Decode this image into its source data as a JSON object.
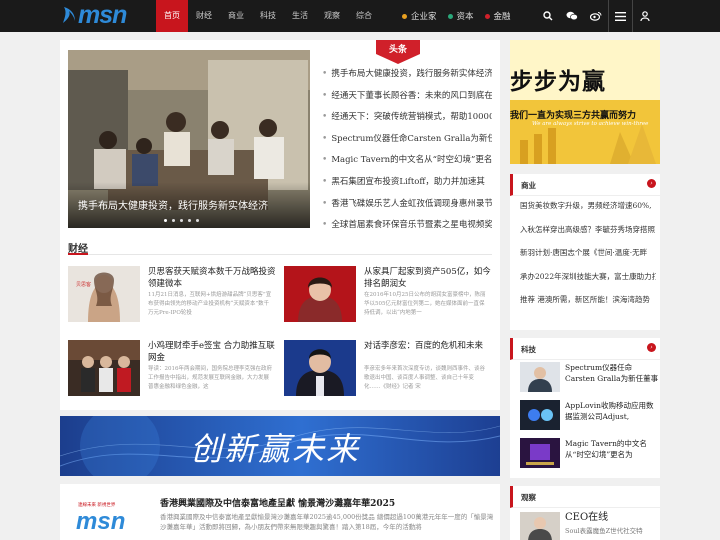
{
  "logo": {
    "text": "msn"
  },
  "nav": [
    "首页",
    "财经",
    "商业",
    "科技",
    "生活",
    "观察",
    "综合"
  ],
  "channels": [
    {
      "label": "企业家",
      "color": "#e8a020"
    },
    {
      "label": "资本",
      "color": "#2aa87a"
    },
    {
      "label": "金融",
      "color": "#d0202a"
    }
  ],
  "tools": [
    "search-icon",
    "wechat-icon",
    "weibo-icon",
    "menu-icon",
    "user-icon"
  ],
  "headline_tag": "头条",
  "slider": {
    "caption": "携手布局大健康投资，践行服务新实体经济",
    "active_dot": 0,
    "dot_count": 5
  },
  "headlines": [
    "携手布局大健康投资，践行服务新实体经济",
    "经通天下董事长顾谷香：未来的风口到底在",
    "经通天下：突破传统营销模式，帮助10000",
    "Spectrum仪器任命Carsten Gralla为新任董",
    "Magic Tavern的中文名从“时空幻境”更名",
    "黑石集团宣布投资Liftoff，助力并加速其",
    "香港飞碟娱乐艺人金虹孜低调现身惠州录节",
    "全球首届素食环保音乐节暨素之星电视频奖"
  ],
  "finance": {
    "title": "财经",
    "items": [
      {
        "title": "贝思客获天赋资本数千万战略投资领建微本",
        "summary": "11月21日消息，互联网+烘焙游甜品牌“贝思客”宣布获得由领先的移动产业投资机构“天赋资本”数千万元Pre-IPO轮投"
      },
      {
        "title": "从家具厂起家到资产505亿，如今排名朗润女",
        "summary": "在2016年10月25日公布的胡润女富豪榜中，陈丽华以505亿元财富位列第二，她在媒体面前一直保持低调，以出“内地第一"
      },
      {
        "title": "小鸡理财牵手e签宝 合力助推互联网金",
        "summary": "导读：2016年两会期间，国务院总理李克强在政府工作报告中指出，规范发展互联网金融，大力发展普惠金融和绿色金融，这"
      },
      {
        "title": "对话李彦宏：百度的危机和未来",
        "summary": "李彦宏多年来首次深度专访，谈魏则西事件、谈谷歌退出中国、谈百度人事调整、谈自己十年变化……《财经》记者 宋"
      }
    ]
  },
  "banner": {
    "text": "创新赢未来"
  },
  "bottom_news": {
    "logo_tagline": "連線未來 新視世界",
    "logo_text": "msn",
    "title": "香港興業國際及中信泰富地產呈獻 愉景灣沙灘嘉年華2025",
    "summary": "香港興業國際及中信泰富地產呈獻愉景灣沙灘嘉年華2025逾45,000份獎品 總價超過100萬港元年年一度的「愉景灣沙灘嘉年華」活動即將回歸，為小朋友們帶來無限樂趣與驚喜！踏入第18屆，今年的活動將"
  },
  "ad": {
    "title": "步步为赢",
    "subtitle": "我们一直为实现三方共赢而努力",
    "english": "We are always strive to achieve win-three"
  },
  "business": {
    "title": "商业",
    "items": [
      "国货美妆数字升级，男频经济增速60%,",
      "入秋怎样穿出高级感？李毓芬秀场穿搭照",
      "新羽计划·唐国志个展《世间·温度·无畔",
      "承办2022年深圳技能大赛，富士康助力打",
      "推荐 港澳所需，新区所能！滨海湾趋势"
    ]
  },
  "tech": {
    "title": "科技",
    "items": [
      {
        "text": "Spectrum仪器任命Carsten Gralla为新任董事"
      },
      {
        "text": "AppLovin收购移动应用数据监测公司Adjust,"
      },
      {
        "text": "Magic Tavern的中文名从“时空幻境”更名为"
      }
    ]
  },
  "observe": {
    "title": "观察",
    "items": [
      {
        "title": "CEO在线",
        "summary": "Soul表露魔鱼Z世代社交特"
      }
    ]
  }
}
